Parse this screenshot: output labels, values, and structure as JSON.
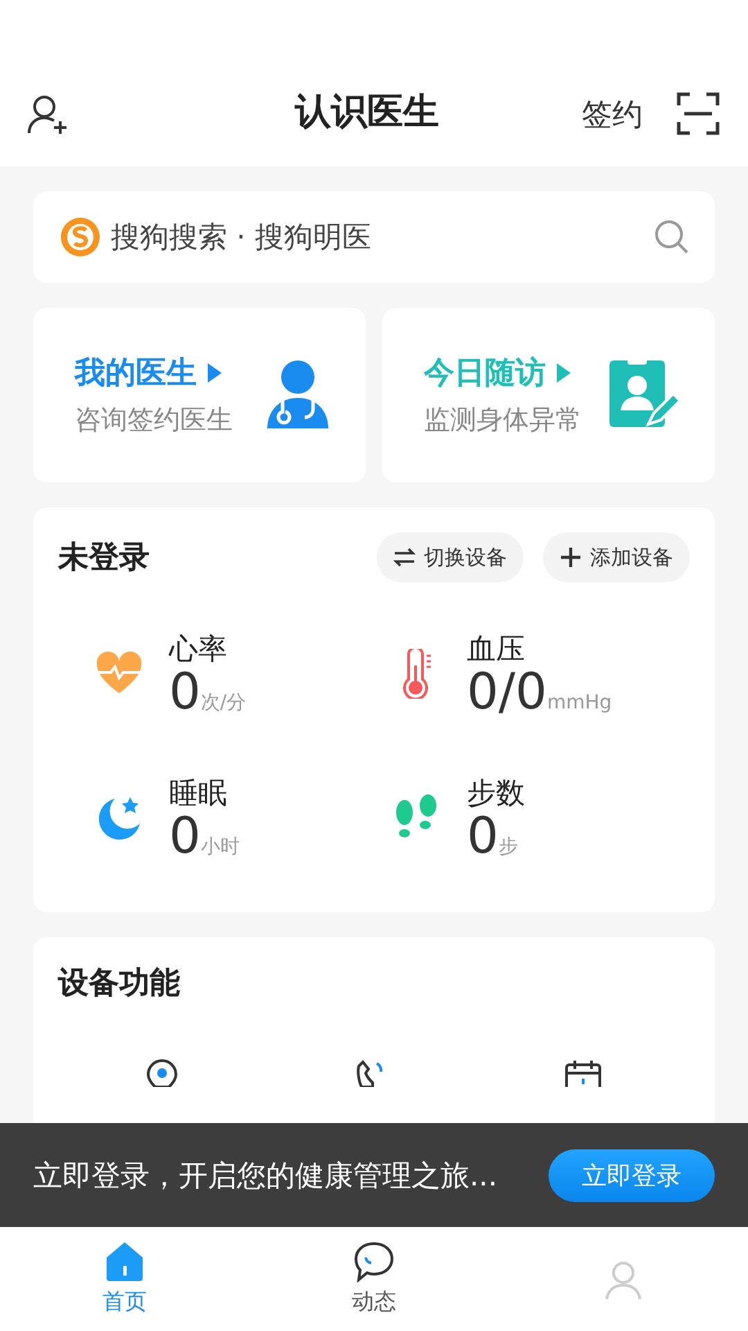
{
  "header": {
    "title": "认识医生",
    "sign_link": "签约"
  },
  "search": {
    "placeholder": "搜狗搜索 · 搜狗明医"
  },
  "quick_cards": [
    {
      "kind": "doctor",
      "title": "我的医生",
      "subtitle": "咨询签约医生",
      "color": "#1a8cf0"
    },
    {
      "kind": "visit",
      "title": "今日随访",
      "subtitle": "监测身体异常",
      "color": "#1fbfb8"
    }
  ],
  "device": {
    "status": "未登录",
    "buttons": [
      {
        "kind": "switch",
        "label": "切换设备"
      },
      {
        "kind": "add",
        "label": "添加设备"
      }
    ],
    "metrics": [
      {
        "kind": "heart",
        "name": "心率",
        "value": "0",
        "unit": "次/分"
      },
      {
        "kind": "pressure",
        "name": "血压",
        "value": "0/0",
        "unit": "mmHg"
      },
      {
        "kind": "sleep",
        "name": "睡眠",
        "value": "0",
        "unit": "小时"
      },
      {
        "kind": "steps",
        "name": "步数",
        "value": "0",
        "unit": "步"
      }
    ]
  },
  "functions": {
    "title": "设备功能",
    "items": [
      {
        "kind": "location"
      },
      {
        "kind": "phone"
      },
      {
        "kind": "calendar"
      }
    ]
  },
  "toast": {
    "text": "立即登录，开启您的健康管理之旅...",
    "button": "立即登录"
  },
  "tabs": [
    {
      "kind": "home",
      "label": "首页",
      "selected": true
    },
    {
      "kind": "chat",
      "label": "动态",
      "selected": false
    },
    {
      "kind": "person",
      "selected": false
    }
  ]
}
